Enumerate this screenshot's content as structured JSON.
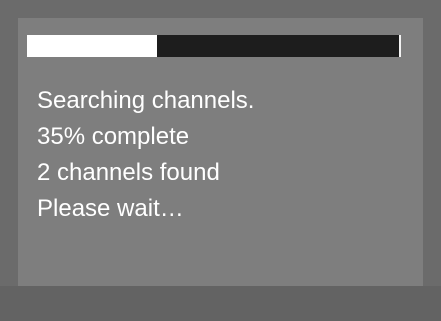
{
  "progress": {
    "fraction": 0.35,
    "fill_color": "#ffffff",
    "track_color": "#1d1d1d"
  },
  "status": {
    "lines": [
      "Searching channels.",
      "35% complete",
      "2 channels found",
      "Please wait…"
    ]
  },
  "colors": {
    "screen_background": "#6b6b6b",
    "dialog_background": "#7e7e7e",
    "text": "#ffffff"
  }
}
